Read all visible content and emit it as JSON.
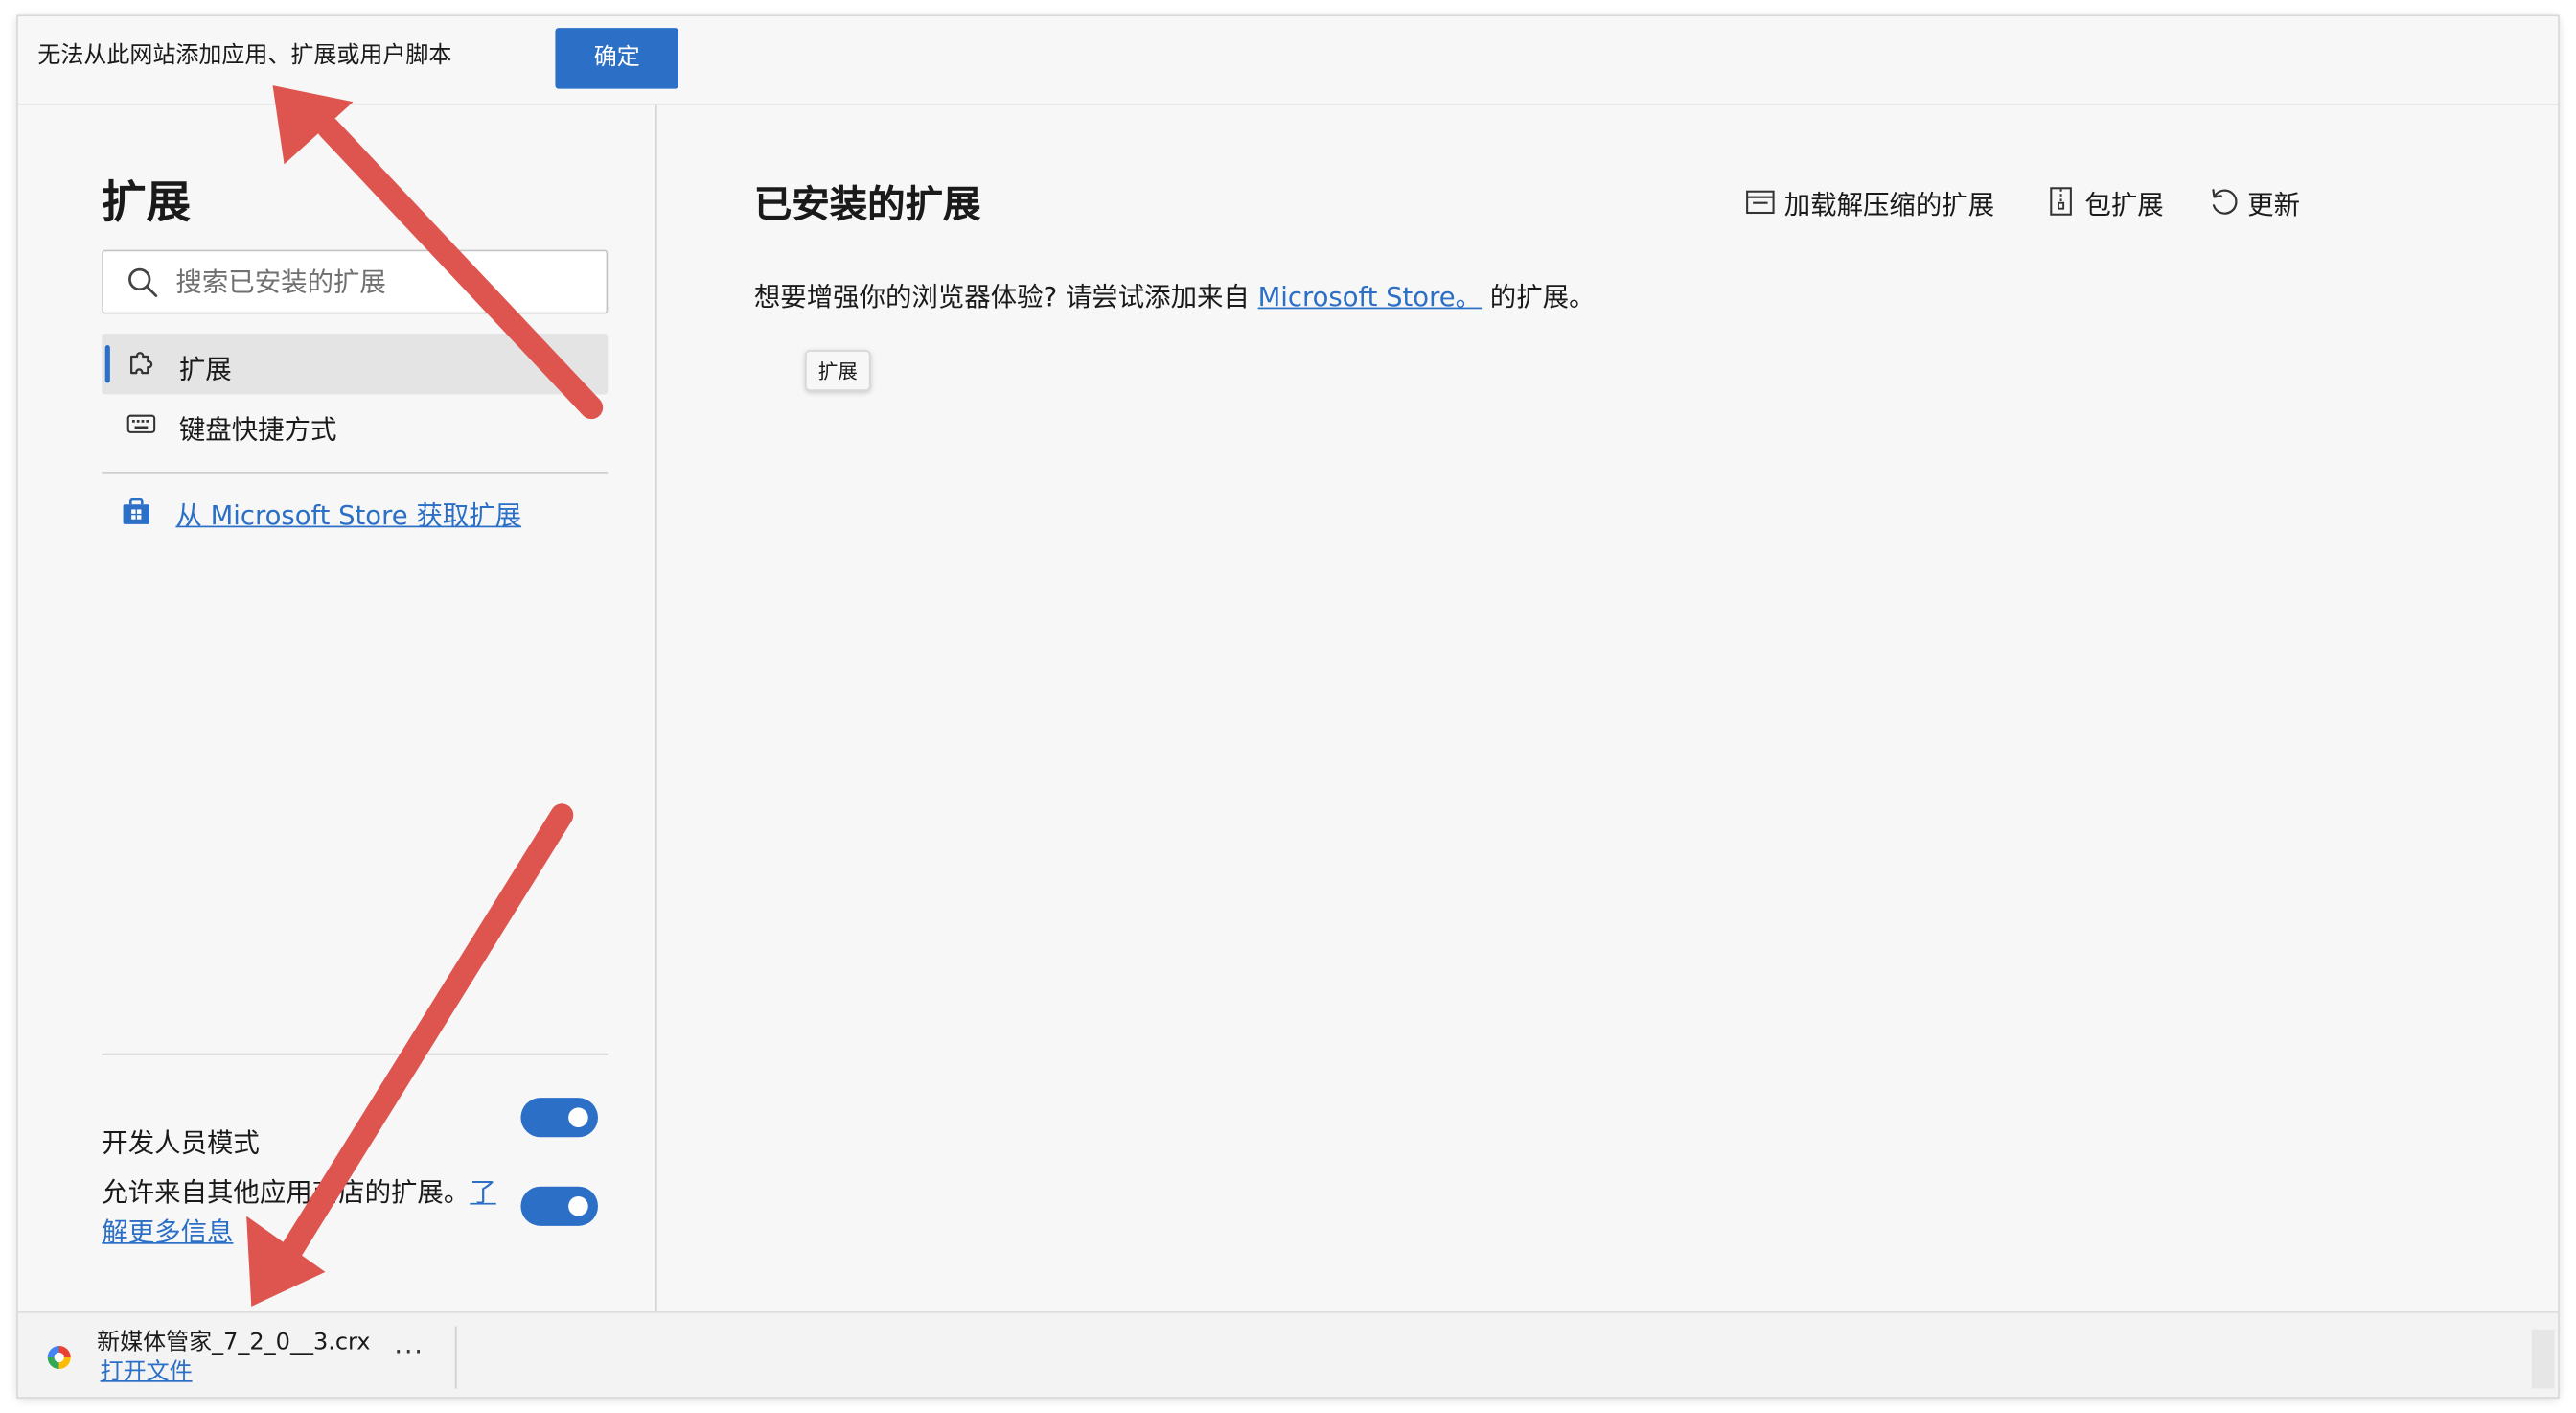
{
  "infobar": {
    "message": "无法从此网站添加应用、扩展或用户脚本",
    "ok_label": "确定"
  },
  "sidebar": {
    "title": "扩展",
    "search_placeholder": "搜索已安装的扩展",
    "items": [
      {
        "label": "扩展",
        "icon": "puzzle-icon",
        "active": true
      },
      {
        "label": "键盘快捷方式",
        "icon": "keyboard-icon",
        "active": false
      }
    ],
    "store_link": "从 Microsoft Store 获取扩展",
    "developer_mode_label": "开发人员模式",
    "developer_mode_on": true,
    "allow_other_stores_text": "允许来自其他应用商店的扩展。",
    "learn_more": "了解更多信息",
    "allow_other_stores_on": true
  },
  "main": {
    "title": "已安装的扩展",
    "actions": [
      {
        "label": "加载解压缩的扩展",
        "icon": "folder-icon"
      },
      {
        "label": "包扩展",
        "icon": "zip-icon"
      },
      {
        "label": "更新",
        "icon": "refresh-icon"
      }
    ],
    "subtitle_before": "想要增强你的浏览器体验? 请尝试添加来自 ",
    "subtitle_link": "Microsoft Store。",
    "subtitle_after": " 的扩展。",
    "tooltip": "扩展"
  },
  "download": {
    "filename": "新媒体管家_7_2_0__3.crx",
    "open_label": "打开文件",
    "more_label": "···"
  },
  "colors": {
    "accent": "#2b6fc6",
    "annotation_arrow": "#de5550"
  }
}
